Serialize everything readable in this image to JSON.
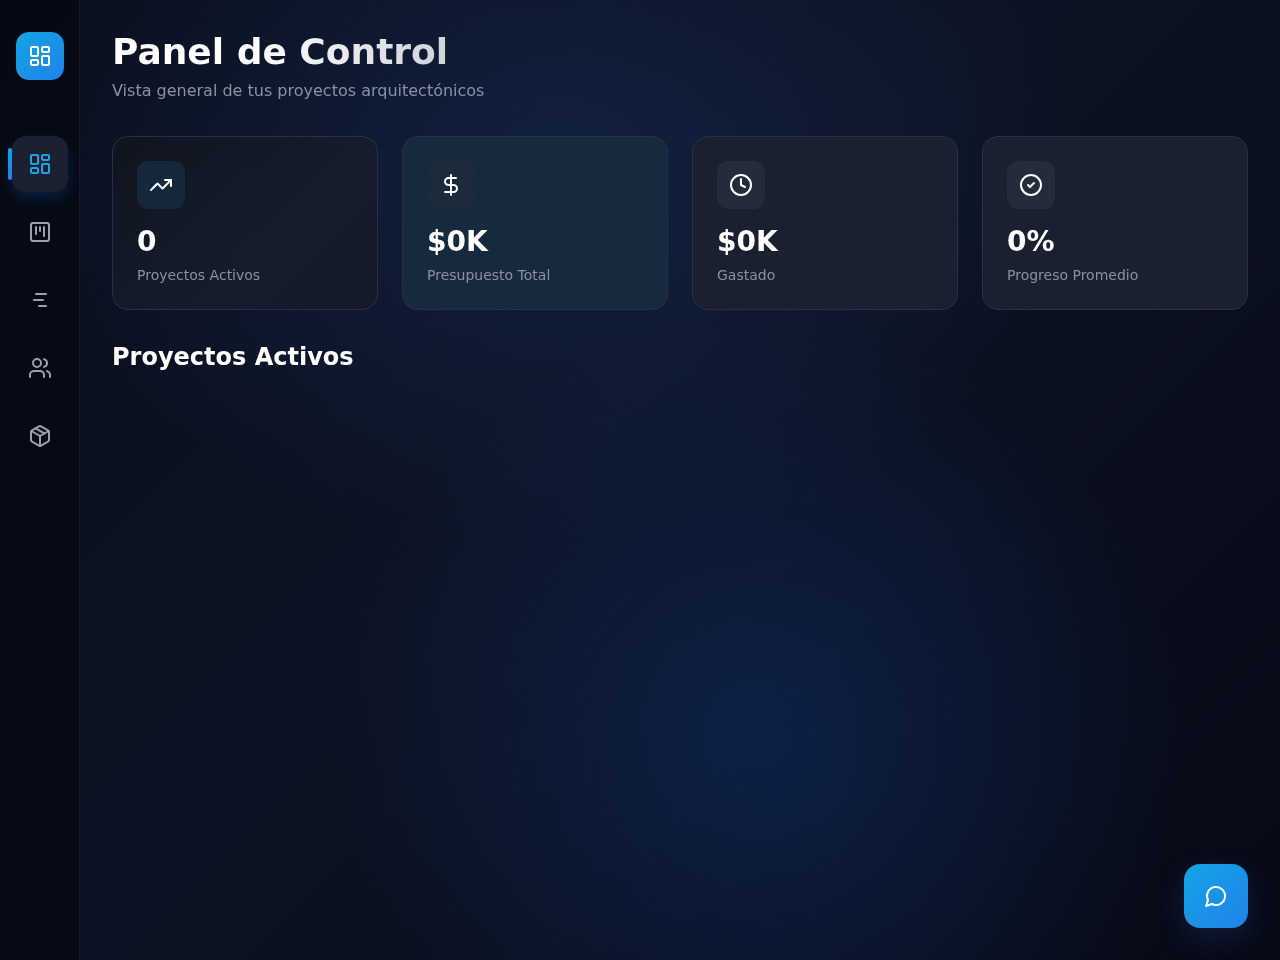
{
  "sidebar": {
    "nav_items": [
      {
        "selected": true
      },
      {
        "selected": false
      },
      {
        "selected": false
      },
      {
        "selected": false
      },
      {
        "selected": false
      }
    ]
  },
  "header": {
    "title": "Panel de Control",
    "subtitle": "Vista general de tus proyectos arquitectónicos"
  },
  "stats": [
    {
      "value": "0",
      "label": "Proyectos Activos"
    },
    {
      "value": "$0K",
      "label": "Presupuesto Total"
    },
    {
      "value": "$0K",
      "label": "Gastado"
    },
    {
      "value": "0%",
      "label": "Progreso Promedio"
    }
  ],
  "section": {
    "title": "Proyectos Activos"
  }
}
